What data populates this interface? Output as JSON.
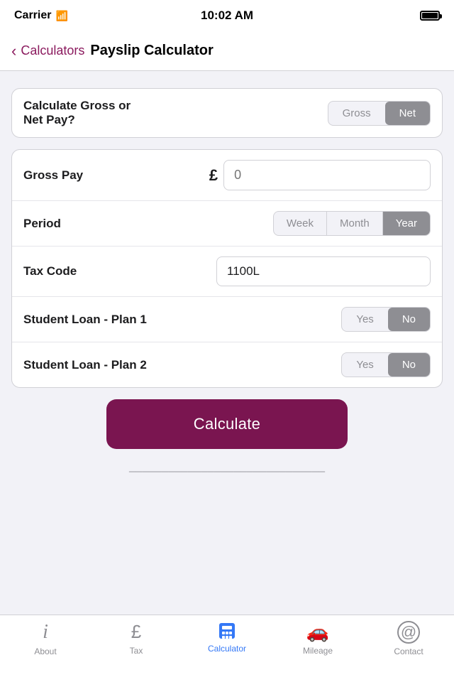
{
  "statusBar": {
    "carrier": "Carrier",
    "time": "10:02 AM"
  },
  "navBar": {
    "backLabel": "Calculators",
    "title": "Payslip Calculator"
  },
  "grossOrNet": {
    "label": "Calculate Gross or\nNet Pay?",
    "options": [
      "Gross",
      "Net"
    ],
    "selected": "Net"
  },
  "grossPay": {
    "label": "Gross Pay",
    "currencySymbol": "£",
    "placeholder": "0"
  },
  "period": {
    "label": "Period",
    "options": [
      "Week",
      "Month",
      "Year"
    ],
    "selected": "Year"
  },
  "taxCode": {
    "label": "Tax Code",
    "value": "1100L"
  },
  "studentLoanPlan1": {
    "label": "Student Loan - Plan 1",
    "options": [
      "Yes",
      "No"
    ],
    "selected": "No"
  },
  "studentLoanPlan2": {
    "label": "Student Loan - Plan 2",
    "options": [
      "Yes",
      "No"
    ],
    "selected": "No"
  },
  "calculateButton": {
    "label": "Calculate"
  },
  "tabBar": {
    "items": [
      {
        "id": "about",
        "label": "About",
        "icon": "ℹ"
      },
      {
        "id": "tax",
        "label": "Tax",
        "icon": "£"
      },
      {
        "id": "calculator",
        "label": "Calculator",
        "icon": "calc",
        "active": true
      },
      {
        "id": "mileage",
        "label": "Mileage",
        "icon": "🚗"
      },
      {
        "id": "contact",
        "label": "Contact",
        "icon": "@"
      }
    ]
  }
}
